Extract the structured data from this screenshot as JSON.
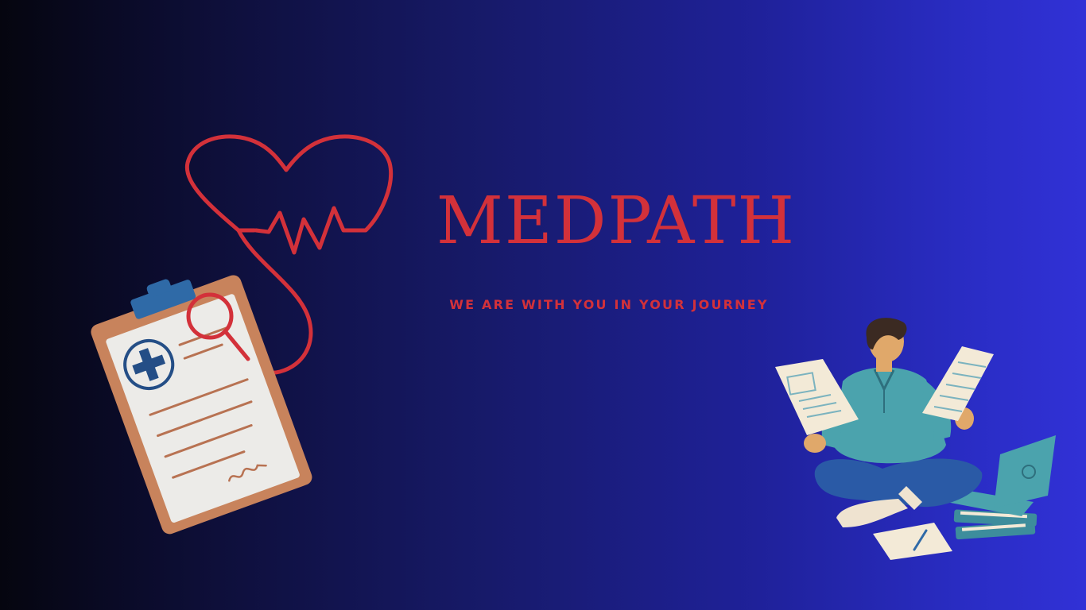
{
  "brand": {
    "title": "MEDPATH",
    "tagline": "WE ARE WITH YOU IN YOUR JOURNEY"
  },
  "colors": {
    "accent": "#d3313a",
    "background_left": "#05050f",
    "background_right": "#3131d6"
  },
  "icons": {
    "heart_stethoscope": "heartbeat-stethoscope-icon",
    "clipboard": "medical-clipboard-icon",
    "person": "person-reading-documents-illustration"
  }
}
